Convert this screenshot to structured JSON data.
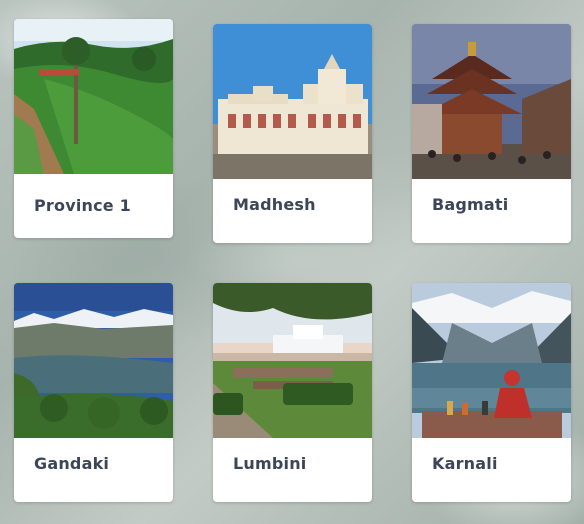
{
  "provinces": [
    {
      "name": "Province 1"
    },
    {
      "name": "Madhesh"
    },
    {
      "name": "Bagmati"
    },
    {
      "name": "Gandaki"
    },
    {
      "name": "Lumbini"
    },
    {
      "name": "Karnali"
    }
  ]
}
